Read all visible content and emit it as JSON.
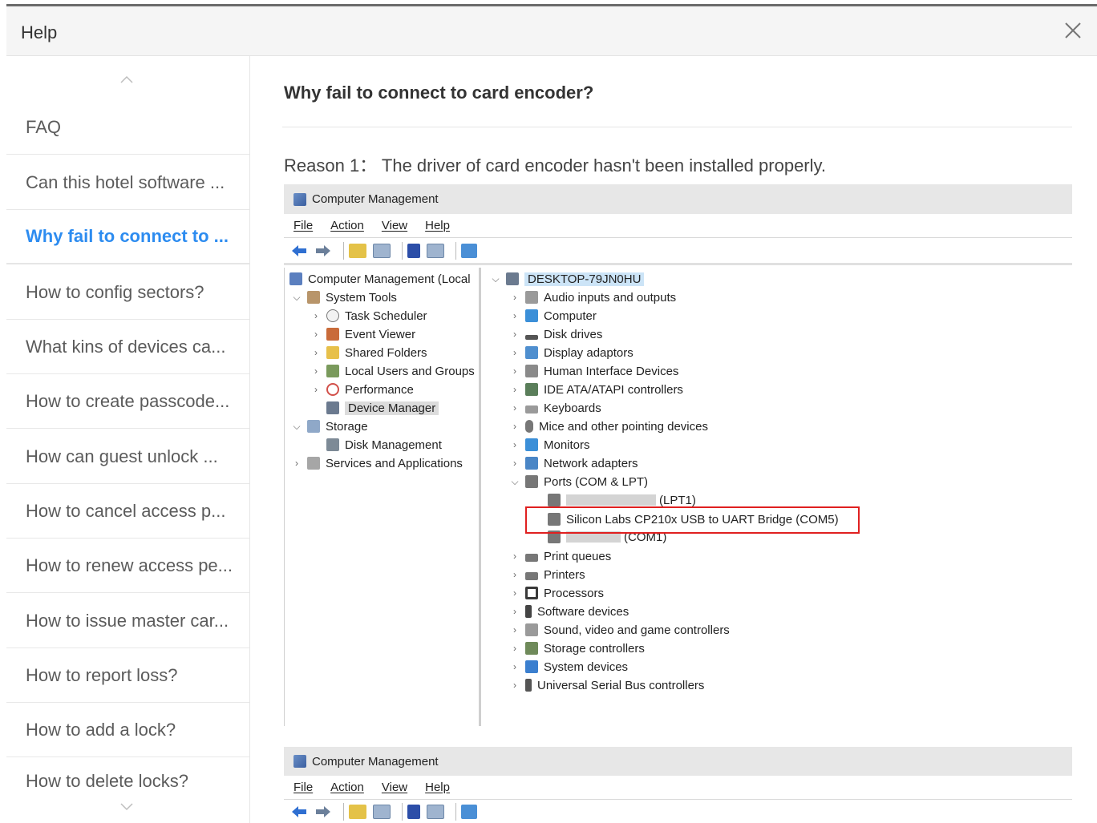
{
  "header": {
    "title": "Help"
  },
  "sidebar": {
    "section": "FAQ",
    "items": [
      "Can this hotel software ...",
      "Why fail to connect to ...",
      "How to config sectors?",
      "What kins of devices ca...",
      "How to create passcode...",
      "How can guest unlock ...",
      "How to cancel access p...",
      "How to renew access pe...",
      "How to issue master car...",
      "How to report loss?",
      "How to add a lock?",
      "How to delete locks?"
    ],
    "active_index": 1
  },
  "article": {
    "title": "Why fail to connect to card encoder?",
    "reason": "Reason 1： The driver of card encoder hasn't been installed properly."
  },
  "cm": {
    "window_title": "Computer Management",
    "menu": [
      "File",
      "Action",
      "View",
      "Help"
    ],
    "tree": [
      "Computer Management (Local",
      "System Tools",
      "Task Scheduler",
      "Event Viewer",
      "Shared Folders",
      "Local Users and Groups",
      "Performance",
      "Device Manager",
      "Storage",
      "Disk Management",
      "Services and Applications"
    ],
    "computer_name": "DESKTOP-79JN0HU",
    "devices": [
      "Audio inputs and outputs",
      "Computer",
      "Disk drives",
      "Display adaptors",
      "Human Interface Devices",
      "IDE ATA/ATAPI controllers",
      "Keyboards",
      "Mice and other pointing devices",
      "Monitors",
      "Network adapters",
      "Ports (COM & LPT)",
      "(LPT1)",
      "Silicon Labs CP210x USB to UART Bridge (COM5)",
      "(COM1)",
      "Print queues",
      "Printers",
      "Processors",
      "Software devices",
      "Sound, video and game controllers",
      "Storage controllers",
      "System devices",
      "Universal Serial Bus controllers"
    ]
  },
  "colors": {
    "accent": "#2d8cf0",
    "highlight_box": "#e02020"
  }
}
